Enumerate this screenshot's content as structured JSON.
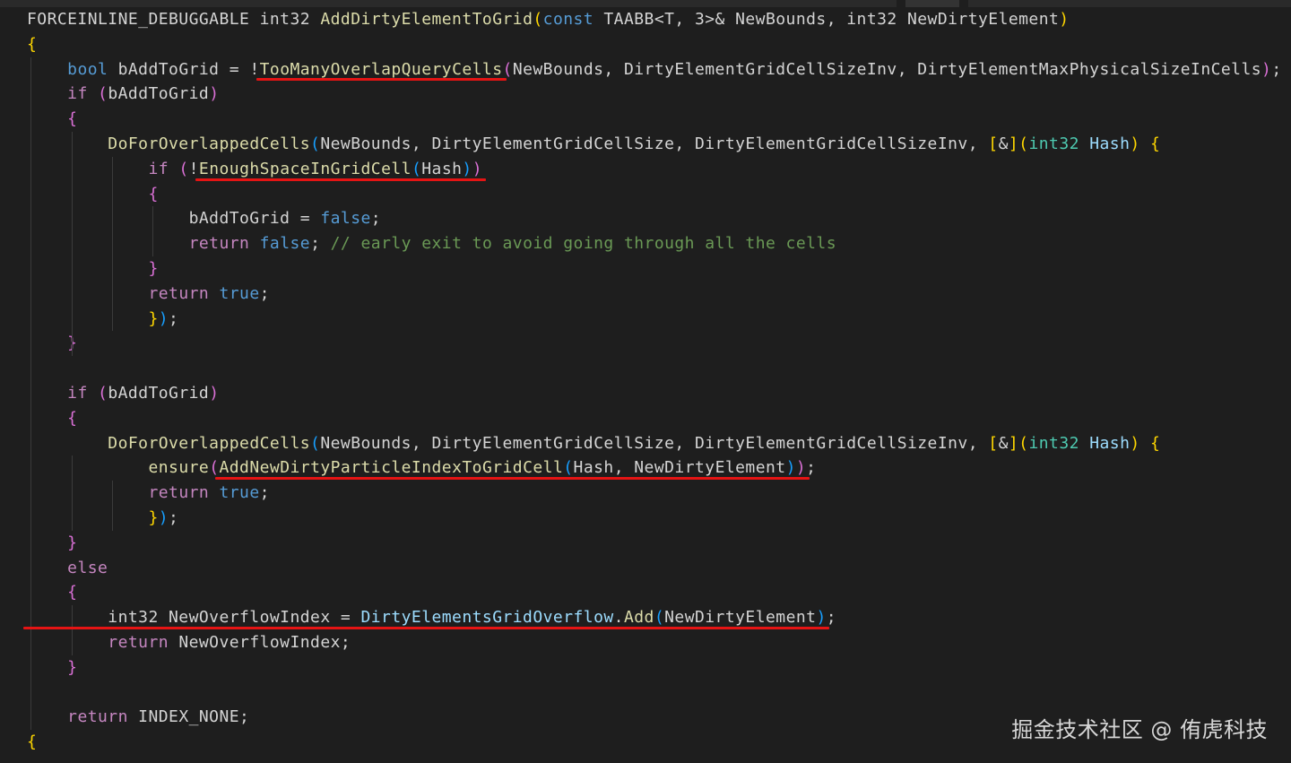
{
  "colors": {
    "background": "#1e1e1e",
    "plain": "#d4d4d4",
    "keyword": "#569cd6",
    "control": "#c586c0",
    "function": "#dcdcaa",
    "type": "#4ec9b0",
    "variable": "#9cdcfe",
    "bracket_gold": "#ffd700",
    "bracket_purple": "#da70d6",
    "bracket_blue": "#179fff",
    "comment": "#6a9955",
    "underline": "#e51414"
  },
  "code": {
    "lines": [
      [
        [
          "FORCEINLINE_DEBUGGABLE int32 ",
          "plain"
        ],
        [
          "AddDirtyElementToGrid",
          "function"
        ],
        [
          "(",
          "bracket_gold"
        ],
        [
          "const",
          "keyword"
        ],
        [
          " TAABB<T, 3>& NewBounds, int32 NewDirtyElement",
          "plain"
        ],
        [
          ")",
          "bracket_gold"
        ]
      ],
      [
        [
          "{",
          "bracket_gold"
        ]
      ],
      [
        [
          "    ",
          "plain"
        ],
        [
          "bool",
          "keyword"
        ],
        [
          " bAddToGrid = !",
          "plain"
        ],
        [
          "TooManyOverlapQueryCells",
          "function"
        ],
        [
          "(",
          "bracket_purple"
        ],
        [
          "NewBounds, DirtyElementGridCellSizeInv, DirtyElementMaxPhysicalSizeInCells",
          "plain"
        ],
        [
          ")",
          "bracket_purple"
        ],
        [
          ";",
          "plain"
        ]
      ],
      [
        [
          "    ",
          "plain"
        ],
        [
          "if",
          "control"
        ],
        [
          " ",
          "plain"
        ],
        [
          "(",
          "bracket_purple"
        ],
        [
          "bAddToGrid",
          "plain"
        ],
        [
          ")",
          "bracket_purple"
        ]
      ],
      [
        [
          "    ",
          "plain"
        ],
        [
          "{",
          "bracket_purple"
        ]
      ],
      [
        [
          "        ",
          "plain"
        ],
        [
          "DoForOverlappedCells",
          "function"
        ],
        [
          "(",
          "bracket_blue"
        ],
        [
          "NewBounds, DirtyElementGridCellSize, DirtyElementGridCellSizeInv, ",
          "plain"
        ],
        [
          "[",
          "bracket_gold"
        ],
        [
          "&",
          "plain"
        ],
        [
          "]",
          "bracket_gold"
        ],
        [
          "(",
          "bracket_gold"
        ],
        [
          "int32",
          "type"
        ],
        [
          " ",
          "plain"
        ],
        [
          "Hash",
          "variable"
        ],
        [
          ")",
          "bracket_gold"
        ],
        [
          " ",
          "plain"
        ],
        [
          "{",
          "bracket_gold"
        ]
      ],
      [
        [
          "            ",
          "plain"
        ],
        [
          "if",
          "control"
        ],
        [
          " ",
          "plain"
        ],
        [
          "(",
          "bracket_purple"
        ],
        [
          "!",
          "plain"
        ],
        [
          "EnoughSpaceInGridCell",
          "function"
        ],
        [
          "(",
          "bracket_blue"
        ],
        [
          "Hash",
          "plain"
        ],
        [
          ")",
          "bracket_blue"
        ],
        [
          ")",
          "bracket_purple"
        ]
      ],
      [
        [
          "            ",
          "plain"
        ],
        [
          "{",
          "bracket_purple"
        ]
      ],
      [
        [
          "                bAddToGrid = ",
          "plain"
        ],
        [
          "false",
          "keyword"
        ],
        [
          ";",
          "plain"
        ]
      ],
      [
        [
          "                ",
          "plain"
        ],
        [
          "return",
          "control"
        ],
        [
          " ",
          "plain"
        ],
        [
          "false",
          "keyword"
        ],
        [
          "; ",
          "plain"
        ],
        [
          "// early exit to avoid going through all the cells",
          "comment"
        ]
      ],
      [
        [
          "            ",
          "plain"
        ],
        [
          "}",
          "bracket_purple"
        ]
      ],
      [
        [
          "            ",
          "plain"
        ],
        [
          "return",
          "control"
        ],
        [
          " ",
          "plain"
        ],
        [
          "true",
          "keyword"
        ],
        [
          ";",
          "plain"
        ]
      ],
      [
        [
          "            ",
          "plain"
        ],
        [
          "}",
          "bracket_gold"
        ],
        [
          ")",
          "bracket_blue"
        ],
        [
          ";",
          "plain"
        ]
      ],
      [
        [
          "    ",
          "plain"
        ],
        [
          "}",
          "bracket_purple"
        ]
      ],
      [],
      [
        [
          "    ",
          "plain"
        ],
        [
          "if",
          "control"
        ],
        [
          " ",
          "plain"
        ],
        [
          "(",
          "bracket_purple"
        ],
        [
          "bAddToGrid",
          "plain"
        ],
        [
          ")",
          "bracket_purple"
        ]
      ],
      [
        [
          "    ",
          "plain"
        ],
        [
          "{",
          "bracket_purple"
        ]
      ],
      [
        [
          "        ",
          "plain"
        ],
        [
          "DoForOverlappedCells",
          "function"
        ],
        [
          "(",
          "bracket_blue"
        ],
        [
          "NewBounds, DirtyElementGridCellSize, DirtyElementGridCellSizeInv, ",
          "plain"
        ],
        [
          "[",
          "bracket_gold"
        ],
        [
          "&",
          "plain"
        ],
        [
          "]",
          "bracket_gold"
        ],
        [
          "(",
          "bracket_gold"
        ],
        [
          "int32",
          "type"
        ],
        [
          " ",
          "plain"
        ],
        [
          "Hash",
          "variable"
        ],
        [
          ")",
          "bracket_gold"
        ],
        [
          " ",
          "plain"
        ],
        [
          "{",
          "bracket_gold"
        ]
      ],
      [
        [
          "            ",
          "plain"
        ],
        [
          "ensure",
          "function"
        ],
        [
          "(",
          "bracket_purple"
        ],
        [
          "AddNewDirtyParticleIndexToGridCell",
          "function"
        ],
        [
          "(",
          "bracket_blue"
        ],
        [
          "Hash, NewDirtyElement",
          "plain"
        ],
        [
          ")",
          "bracket_blue"
        ],
        [
          ")",
          "bracket_purple"
        ],
        [
          ";",
          "plain"
        ]
      ],
      [
        [
          "            ",
          "plain"
        ],
        [
          "return",
          "control"
        ],
        [
          " ",
          "plain"
        ],
        [
          "true",
          "keyword"
        ],
        [
          ";",
          "plain"
        ]
      ],
      [
        [
          "            ",
          "plain"
        ],
        [
          "}",
          "bracket_gold"
        ],
        [
          ")",
          "bracket_blue"
        ],
        [
          ";",
          "plain"
        ]
      ],
      [
        [
          "    ",
          "plain"
        ],
        [
          "}",
          "bracket_purple"
        ]
      ],
      [
        [
          "    ",
          "plain"
        ],
        [
          "else",
          "control"
        ]
      ],
      [
        [
          "    ",
          "plain"
        ],
        [
          "{",
          "bracket_purple"
        ]
      ],
      [
        [
          "        int32 NewOverflowIndex = ",
          "plain"
        ],
        [
          "DirtyElementsGridOverflow",
          "variable"
        ],
        [
          ".",
          "plain"
        ],
        [
          "Add",
          "function"
        ],
        [
          "(",
          "bracket_blue"
        ],
        [
          "NewDirtyElement",
          "plain"
        ],
        [
          ")",
          "bracket_blue"
        ],
        [
          ";",
          "plain"
        ]
      ],
      [
        [
          "        ",
          "plain"
        ],
        [
          "return",
          "control"
        ],
        [
          " NewOverflowIndex;",
          "plain"
        ]
      ],
      [
        [
          "    ",
          "plain"
        ],
        [
          "}",
          "bracket_purple"
        ]
      ],
      [],
      [
        [
          "    ",
          "plain"
        ],
        [
          "return",
          "control"
        ],
        [
          " INDEX_NONE;",
          "plain"
        ]
      ],
      [
        [
          "{",
          "bracket_gold"
        ]
      ]
    ]
  },
  "watermark": "掘金技术社区 @ 侑虎科技"
}
